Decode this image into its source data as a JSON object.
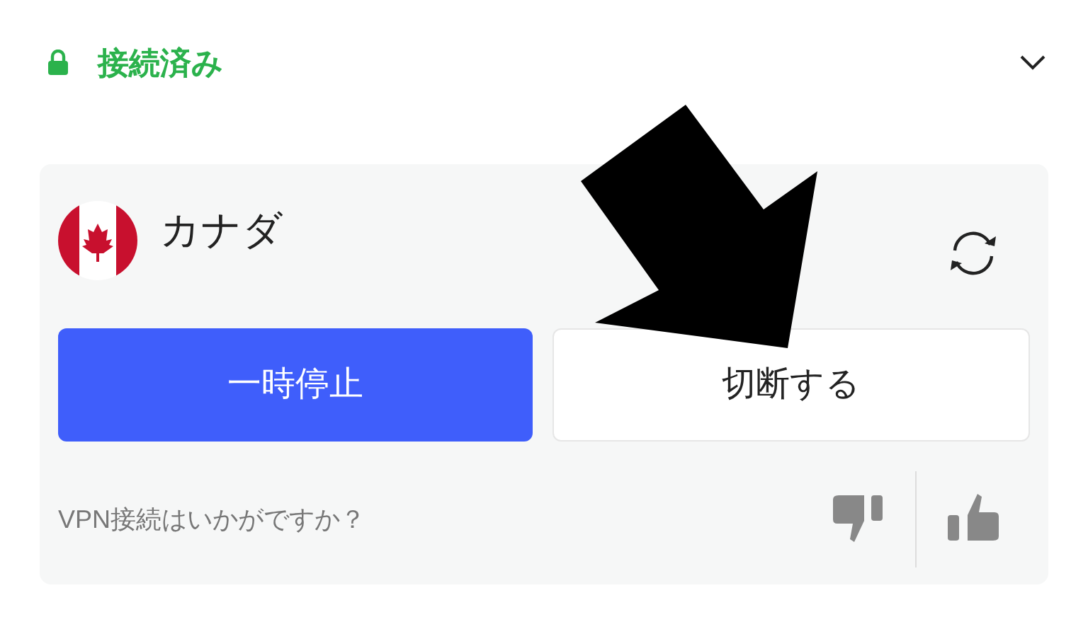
{
  "status": {
    "label": "接続済み",
    "connected": true
  },
  "location": {
    "country": "カナダ"
  },
  "buttons": [
    {
      "label": "一時停止",
      "kind": "primary"
    },
    {
      "label": "切断する",
      "kind": "secondary"
    }
  ],
  "feedback": {
    "question": "VPN接続はいかがですか？"
  }
}
